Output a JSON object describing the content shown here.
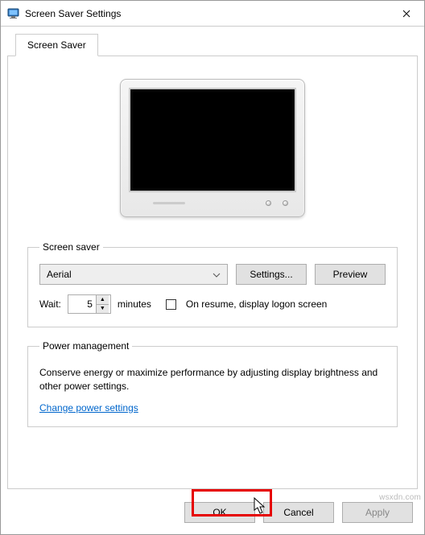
{
  "window": {
    "title": "Screen Saver Settings"
  },
  "tabs": {
    "main": "Screen Saver"
  },
  "screensaver_group": {
    "legend": "Screen saver",
    "dropdown_value": "Aerial",
    "settings_btn": "Settings...",
    "preview_btn": "Preview",
    "wait_label": "Wait:",
    "wait_value": "5",
    "minutes_label": "minutes",
    "resume_label": "On resume, display logon screen"
  },
  "power_group": {
    "legend": "Power management",
    "desc": "Conserve energy or maximize performance by adjusting display brightness and other power settings.",
    "link": "Change power settings"
  },
  "buttons": {
    "ok": "OK",
    "cancel": "Cancel",
    "apply": "Apply"
  },
  "watermark": "wsxdn.com"
}
